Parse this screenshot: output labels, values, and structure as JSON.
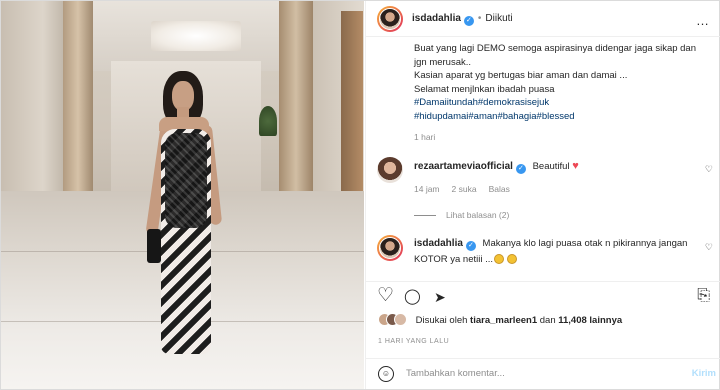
{
  "post": {
    "author": "isdadahlia",
    "follow_status": "Diikuti",
    "dot": "•",
    "more_icon": "…",
    "caption_lines": [
      "Buat yang lagi DEMO semoga aspirasinya didengar jaga sikap dan",
      "jgn merusak..",
      "Kasian aparat yg bertugas biar aman dan damai ...",
      "Selamat menjlnkan ibadah puasa"
    ],
    "hashtags_line1": "#Damaiitundah#demokrasisejuk",
    "hashtags_line2": "#hidupdamai#aman#bahagia#blessed",
    "caption_age": "1 hari"
  },
  "comments": [
    {
      "user": "rezaartameviaofficial",
      "text": "Beautiful",
      "heart_emoji": "♥",
      "age": "14 jam",
      "likes": "2 suka",
      "reply": "Balas",
      "view_replies": "Lihat balasan (2)"
    },
    {
      "user": "isdadahlia",
      "text_line1": "Makanya klo lagi puasa otak n pikirannya jangan",
      "text_line2": "KOTOR ya netiii ..."
    }
  ],
  "likes": {
    "prefix": "Disukai oleh",
    "first_user": "tiara_marleen1",
    "connector": "dan",
    "others": "11,408 lainnya"
  },
  "timestamp": "1 HARI YANG LALU",
  "add_comment": {
    "placeholder": "Tambahkan komentar...",
    "post_label": "Kirim"
  },
  "icons": {
    "verified": "✓",
    "like": "♡",
    "comment": "◯",
    "share": "➤",
    "save": "⎘",
    "emoji": "☺"
  }
}
